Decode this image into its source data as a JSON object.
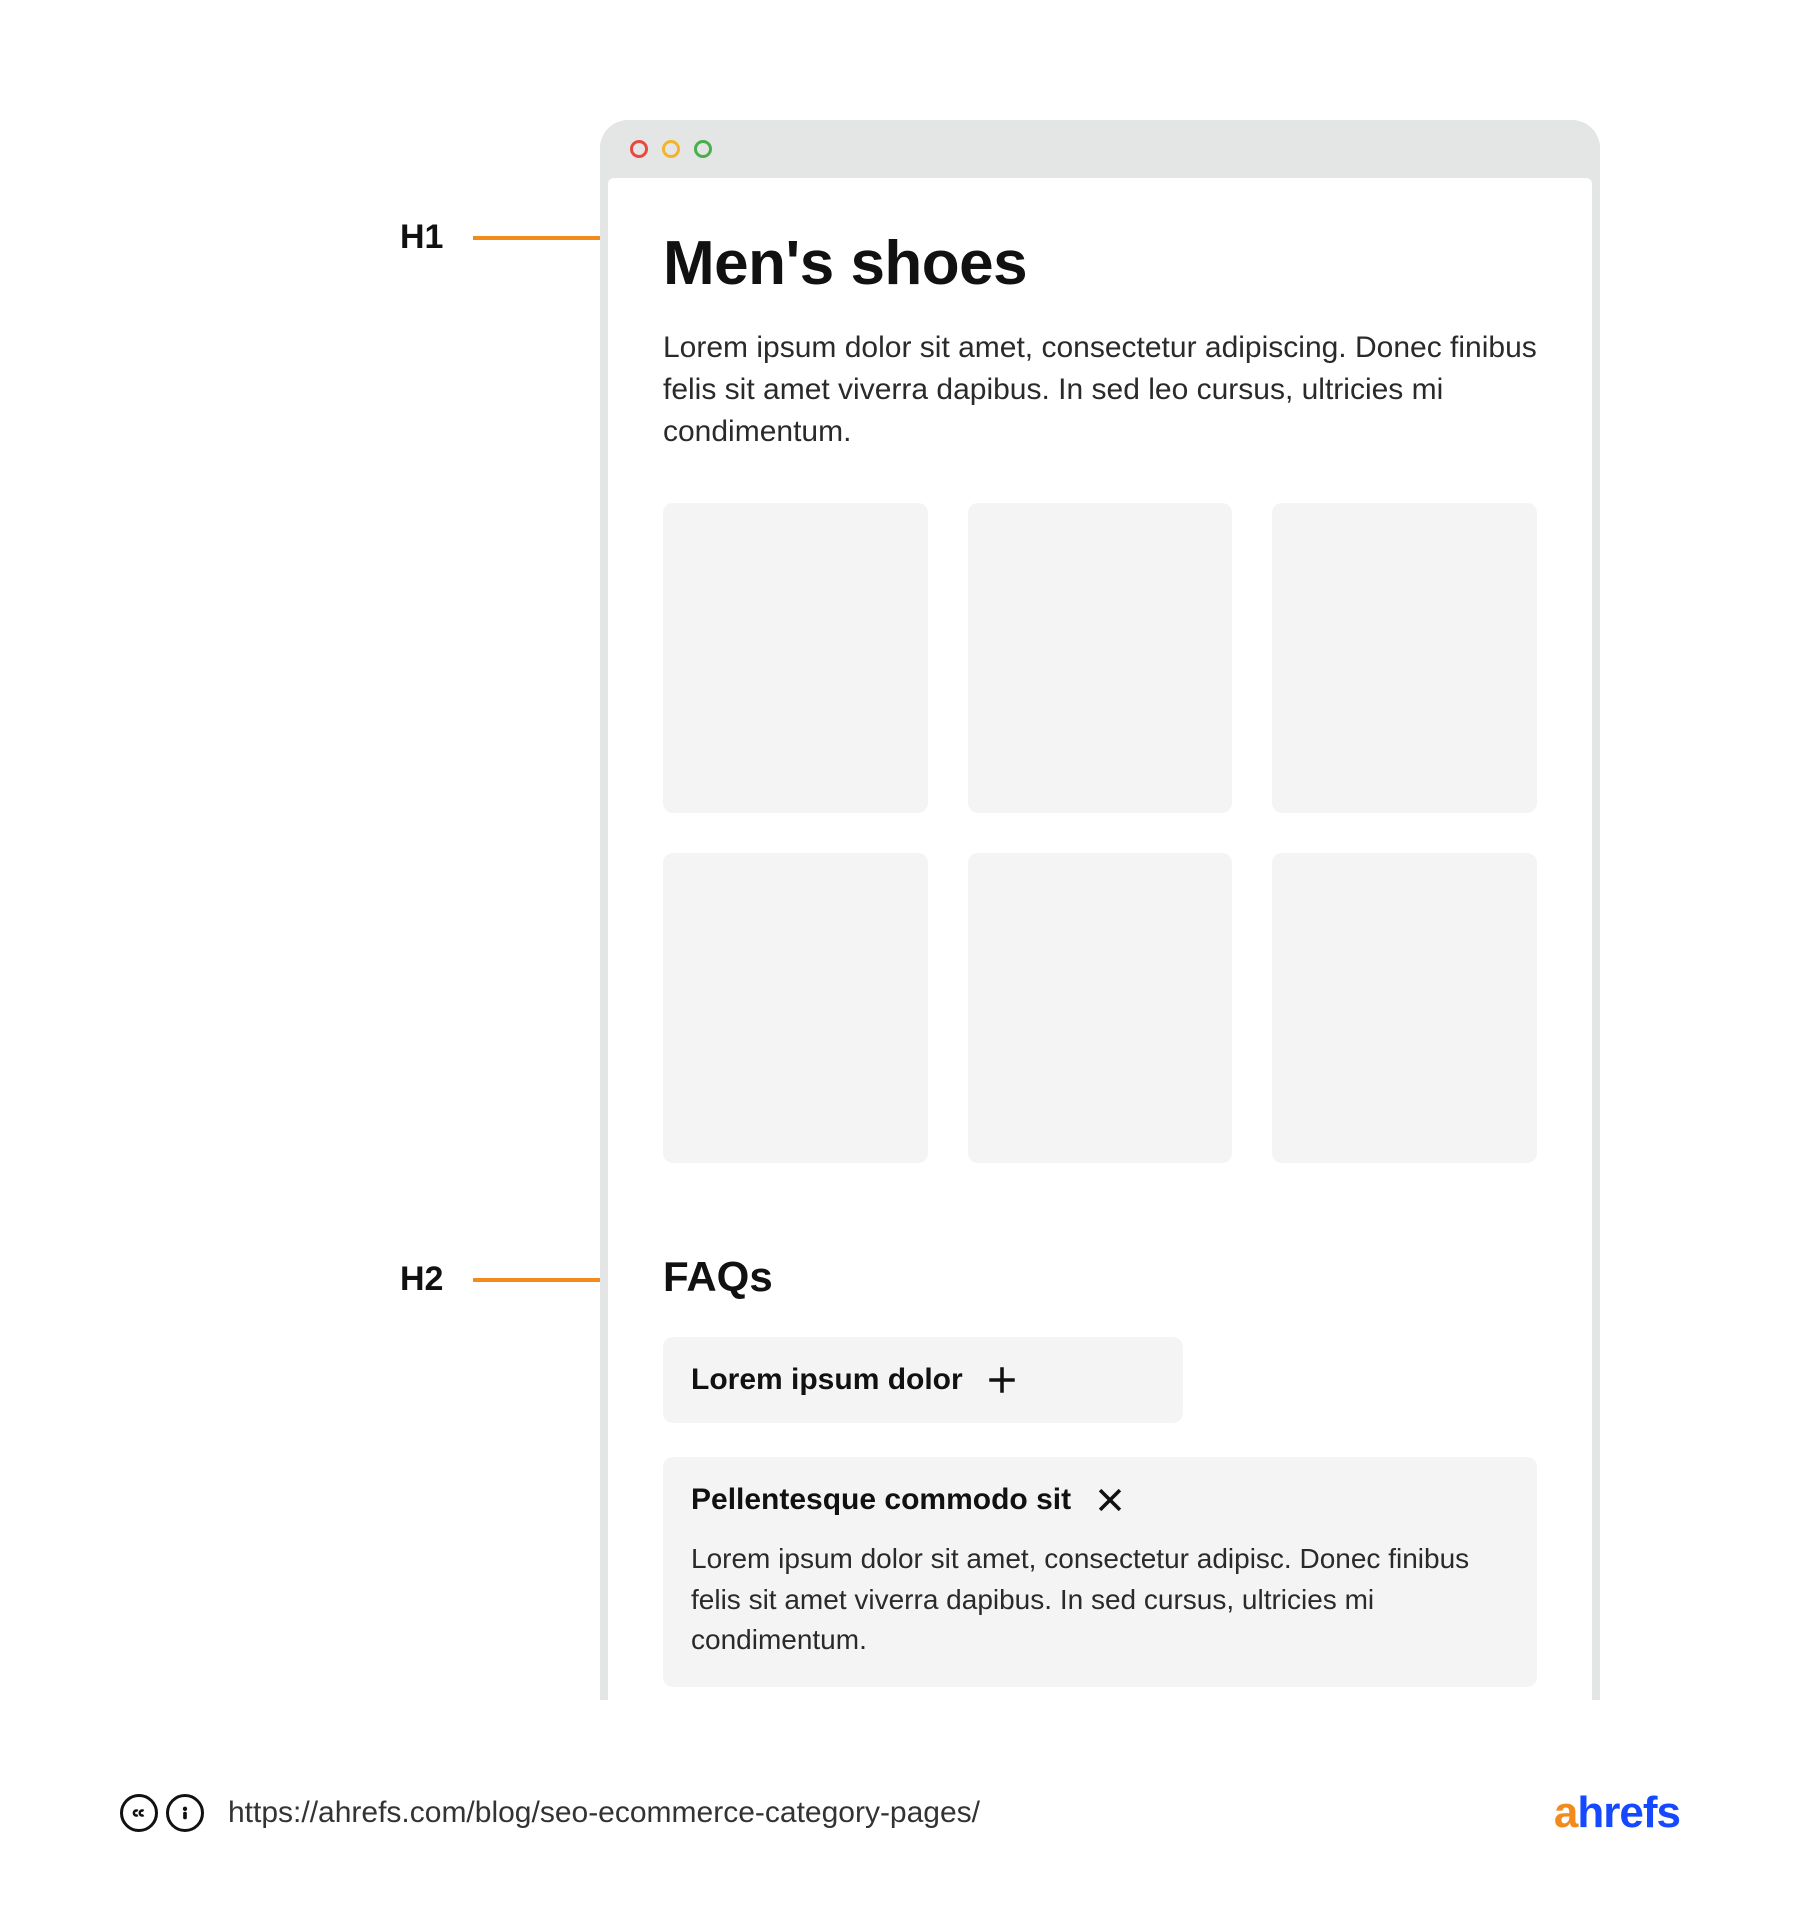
{
  "annotations": {
    "h1_label": "H1",
    "h2_label": "H2"
  },
  "page": {
    "h1": "Men's shoes",
    "intro": "Lorem ipsum dolor sit amet, consectetur adipiscing. Donec finibus felis sit amet viverra dapibus. In sed leo cursus, ultricies mi condimentum.",
    "h2": "FAQs",
    "faqs": [
      {
        "q": "Lorem ipsum dolor",
        "expanded": false
      },
      {
        "q": "Pellentesque commodo sit",
        "expanded": true,
        "a": "Lorem ipsum dolor sit amet, consectetur adipisc. Donec finibus felis sit amet viverra dapibus. In sed cursus, ultricies mi condimentum."
      }
    ]
  },
  "footer": {
    "url": "https://ahrefs.com/blog/seo-ecommerce-category-pages/",
    "brand_a": "a",
    "brand_rest": "hrefs",
    "cc_label": "cc",
    "by_label": "i"
  },
  "colors": {
    "accent": "#f28a1c",
    "brand_blue": "#1549ff"
  }
}
